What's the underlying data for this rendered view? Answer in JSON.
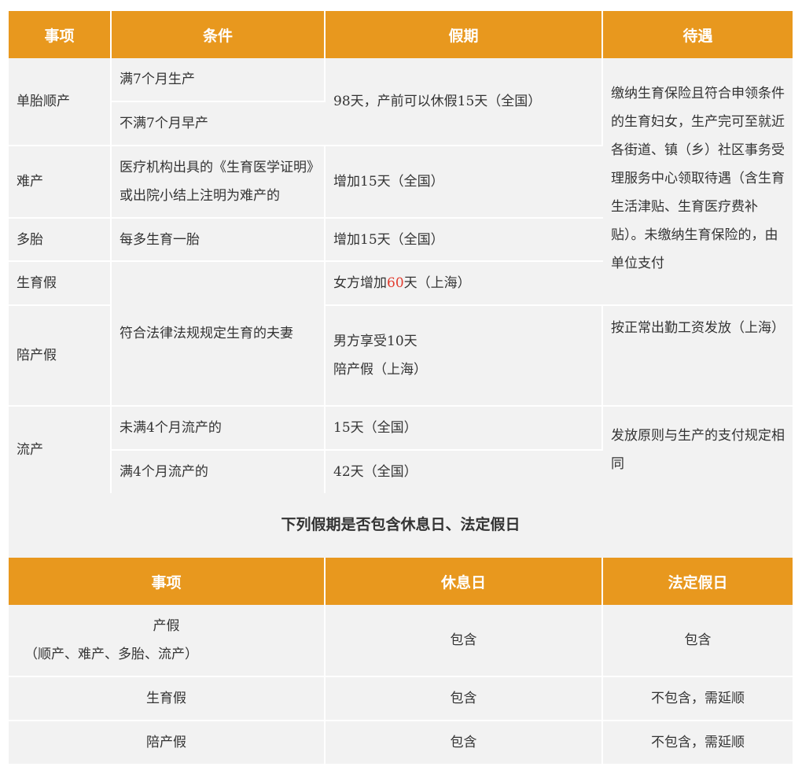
{
  "table1": {
    "headers": [
      "事项",
      "条件",
      "假期",
      "待遇"
    ],
    "r1": {
      "item": "单胎顺产",
      "cond1": "满7个月生产",
      "cond2": "不满7个月早产",
      "leave": "98天，产前可以休假15天（全国）",
      "benefit": "缴纳生育保险且符合申领条件的生育妇女，生产完可至就近各街道、镇（乡）社区事务受理服务中心领取待遇（含生育生活津贴、生育医疗费补贴）。未缴纳生育保险的，由单位支付"
    },
    "r2": {
      "item": "难产",
      "cond": "医疗机构出具的《生育医学证明》或出院小结上注明为难产的",
      "leave": "增加15天（全国）"
    },
    "r3": {
      "item": "多胎",
      "cond": "每多生育一胎",
      "leave": "增加15天（全国）"
    },
    "r4": {
      "item": "生育假",
      "cond": "符合法律法规规定生育的夫妻",
      "leave_pre": "女方增加",
      "leave_num": "60",
      "leave_post": "天（上海）"
    },
    "r5": {
      "item": "陪产假",
      "leave_line1": "男方享受10天",
      "leave_line2": "陪产假（上海）",
      "benefit": "按正常出勤工资发放（上海）"
    },
    "r6": {
      "item": "流产",
      "cond1": "未满4个月流产的",
      "leave1": "15天（全国）",
      "cond2": "满4个月流产的",
      "leave2": "42天（全国）",
      "benefit": "发放原则与生产的支付规定相同"
    }
  },
  "subtitle": "下列假期是否包含休息日、法定假日",
  "table2": {
    "headers": [
      "事项",
      "休息日",
      "法定假日"
    ],
    "rows": [
      {
        "item_line1": "产假",
        "item_line2": "（顺产、难产、多胎、流产）",
        "rest": "包含",
        "holiday": "包含"
      },
      {
        "item": "生育假",
        "rest": "包含",
        "holiday": "不包含，需延顺"
      },
      {
        "item": "陪产假",
        "rest": "包含",
        "holiday": "不包含，需延顺"
      }
    ]
  },
  "colors": {
    "header_bg": "#e8981e",
    "cell_bg": "#f2f2f2",
    "highlight": "#e23b2e"
  }
}
